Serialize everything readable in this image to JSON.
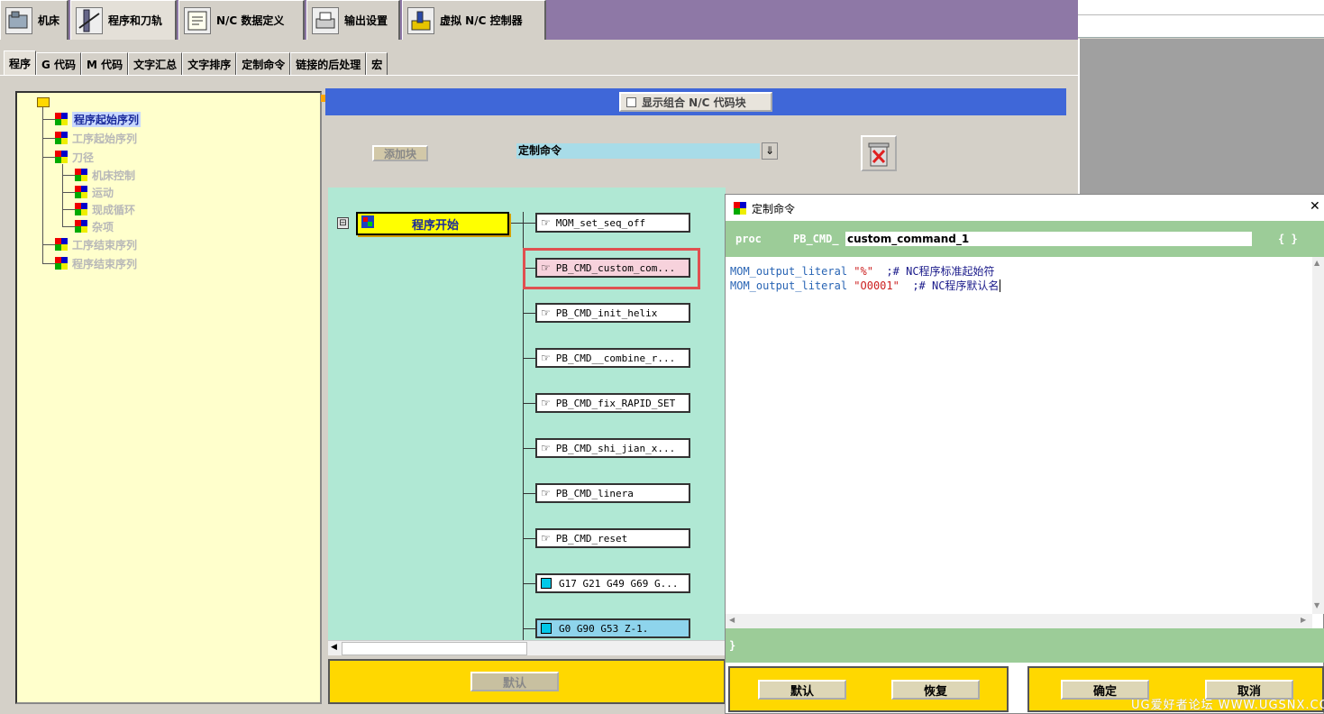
{
  "top_tabs": [
    {
      "label": "机床"
    },
    {
      "label": "程序和刀轨"
    },
    {
      "label": "N/C 数据定义"
    },
    {
      "label": "输出设置"
    },
    {
      "label": "虚拟 N/C 控制器"
    }
  ],
  "sub_tabs": [
    "程序",
    "G 代码",
    "M 代码",
    "文字汇总",
    "文字排序",
    "定制命令",
    "链接的后处理",
    "宏"
  ],
  "tree": {
    "items": [
      {
        "label": "程序起始序列"
      },
      {
        "label": "工序起始序列"
      },
      {
        "label": "刀径"
      },
      {
        "label": "机床控制"
      },
      {
        "label": "运动"
      },
      {
        "label": "现成循环"
      },
      {
        "label": "杂项"
      },
      {
        "label": "工序结束序列"
      },
      {
        "label": "程序结束序列"
      }
    ]
  },
  "toolbar": {
    "show_combined_label": "显示组合 N/C 代码块",
    "add_block_label": "添加块",
    "command_combo_value": "定制命令",
    "dropdown_glyph": "⇓"
  },
  "flow": {
    "start_label": "程序开始",
    "collapse_glyph": "⊟",
    "blocks": [
      {
        "label": "MOM_set_seq_off"
      },
      {
        "label": "PB_CMD_custom_com..."
      },
      {
        "label": "PB_CMD_init_helix"
      },
      {
        "label": "PB_CMD__combine_r..."
      },
      {
        "label": "PB_CMD_fix_RAPID_SET"
      },
      {
        "label": "PB_CMD_shi_jian_x..."
      },
      {
        "label": "PB_CMD_linera"
      },
      {
        "label": "PB_CMD_reset"
      },
      {
        "label": "G17 G21 G49 G69 G..."
      },
      {
        "label": "G0 G90 G53 Z-1."
      }
    ]
  },
  "mid_buttons": {
    "default_label": "默认"
  },
  "dialog": {
    "title": "定制命令",
    "close_glyph": "✕",
    "proc_label": "proc",
    "prefix_label": "PB_CMD_",
    "proc_name": "custom_command_1",
    "brace_label": "{ }",
    "closing_brace": "}",
    "code_lines": [
      {
        "fn": "MOM_output_literal",
        "gap1": " ",
        "arg": "\"%\"",
        "gap2": "  ",
        "comment": ";# NC程序标准起始符"
      },
      {
        "fn": "MOM_output_literal",
        "gap1": " ",
        "arg": "\"O0001\"",
        "gap2": "  ",
        "comment": ";# NC程序默认名"
      }
    ],
    "buttons": {
      "default": "默认",
      "restore": "恢复",
      "ok": "确定",
      "cancel": "取消"
    }
  },
  "watermark": "UG爱好者论坛 WWW.UGSNX.COM",
  "colors": {
    "top_bar": "#8e78a6",
    "header_blue": "#3f67d8",
    "flow_bg": "#b0e8d4",
    "panel_yellow": "#ffd800",
    "dialog_green": "#9ccc98",
    "highlight_red": "#e05050"
  }
}
